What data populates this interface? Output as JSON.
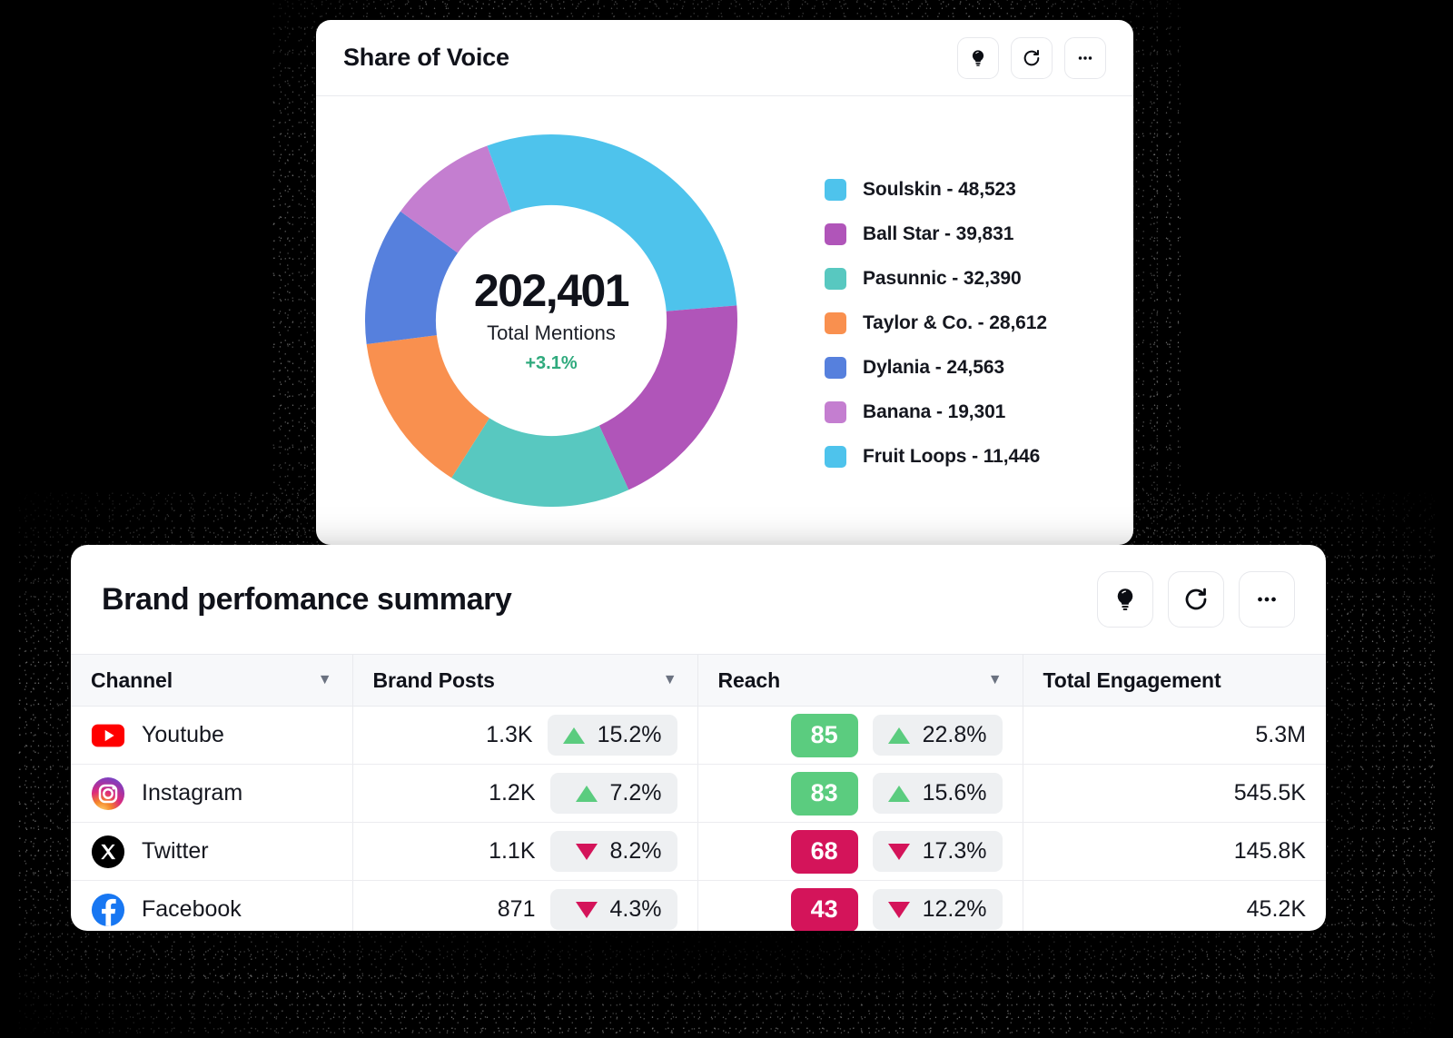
{
  "share_of_voice": {
    "title": "Share of Voice",
    "actions": [
      {
        "name": "insights-button",
        "icon": "lightbulb-icon"
      },
      {
        "name": "refresh-button",
        "icon": "refresh-icon"
      },
      {
        "name": "more-options-button",
        "icon": "ellipsis-icon"
      }
    ],
    "center": {
      "total": "202,401",
      "label": "Total Mentions",
      "delta": "+3.1%",
      "delta_color": "#2faa7d"
    }
  },
  "chart_data": {
    "type": "pie",
    "title": "Share of Voice",
    "subtitle": "Total Mentions",
    "center_value": 202401,
    "center_label": "Total Mentions",
    "center_delta": "+3.1%",
    "categories": [
      "Soulskin",
      "Ball Star",
      "Pasunnic",
      "Taylor & Co.",
      "Dylania",
      "Banana",
      "Fruit Loops"
    ],
    "values": [
      48523,
      39831,
      32390,
      28612,
      24563,
      19301,
      11446
    ],
    "colors": [
      "#4ec3ec",
      "#b055b9",
      "#58c8c0",
      "#f9904f",
      "#5680dd",
      "#c47ed0",
      "#4ec3ec"
    ],
    "legend_labels": [
      "Soulskin - 48,523",
      "Ball Star - 39,831",
      "Pasunnic - 32,390",
      "Taylor & Co. - 28,612",
      "Dylania - 24,563",
      "Banana - 19,301",
      "Fruit Loops - 11,446"
    ],
    "legend_position": "right",
    "donut": true,
    "grid": false
  },
  "brand_summary": {
    "title": "Brand perfomance summary",
    "actions": [
      {
        "name": "insights-button",
        "icon": "lightbulb-icon"
      },
      {
        "name": "refresh-button",
        "icon": "refresh-icon"
      },
      {
        "name": "more-options-button",
        "icon": "ellipsis-icon"
      }
    ],
    "columns": [
      {
        "label": "Channel",
        "sortable": true
      },
      {
        "label": "Brand Posts",
        "sortable": true
      },
      {
        "label": "Reach",
        "sortable": true
      },
      {
        "label": "Total Engagement",
        "sortable": false
      }
    ],
    "sort_caret": "▼",
    "rows": [
      {
        "channel": "Youtube",
        "icon": "youtube-icon",
        "posts": "1.3K",
        "posts_change": "15.2%",
        "posts_dir": "up",
        "reach_score": "85",
        "reach_score_color": "#5bcc7f",
        "reach_change": "22.8%",
        "reach_dir": "up",
        "engagement": "5.3M"
      },
      {
        "channel": "Instagram",
        "icon": "instagram-icon",
        "posts": "1.2K",
        "posts_change": "7.2%",
        "posts_dir": "up",
        "reach_score": "83",
        "reach_score_color": "#5bcc7f",
        "reach_change": "15.6%",
        "reach_dir": "up",
        "engagement": "545.5K"
      },
      {
        "channel": "Twitter",
        "icon": "x-twitter-icon",
        "posts": "1.1K",
        "posts_change": "8.2%",
        "posts_dir": "down",
        "reach_score": "68",
        "reach_score_color": "#d4145a",
        "reach_change": "17.3%",
        "reach_dir": "down",
        "engagement": "145.8K"
      },
      {
        "channel": "Facebook",
        "icon": "facebook-icon",
        "posts": "871",
        "posts_change": "4.3%",
        "posts_dir": "down",
        "reach_score": "43",
        "reach_score_color": "#d4145a",
        "reach_change": "12.2%",
        "reach_dir": "down",
        "engagement": "45.2K"
      }
    ]
  }
}
